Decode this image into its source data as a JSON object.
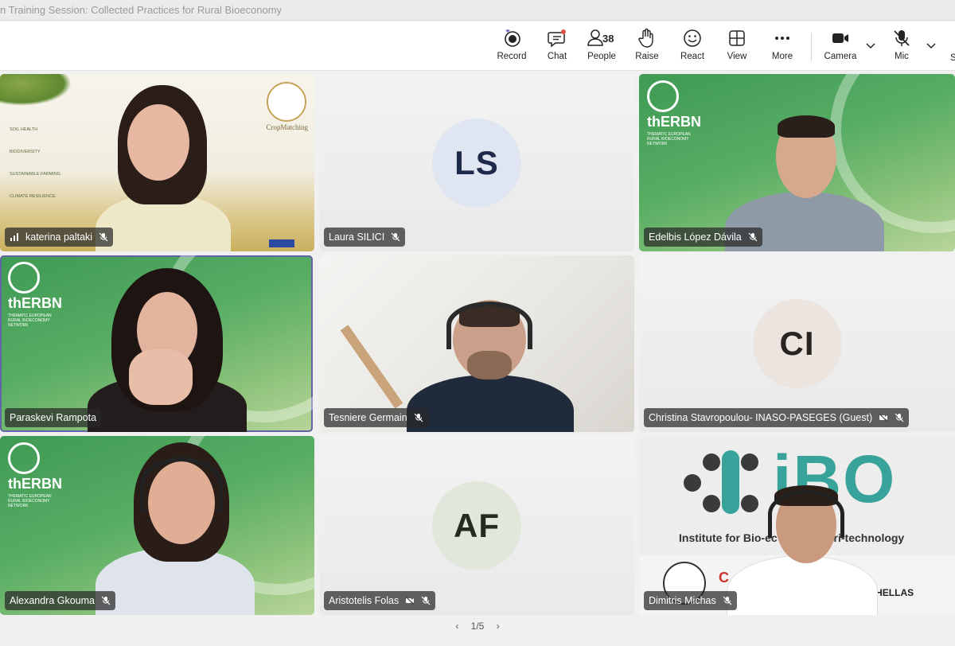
{
  "window": {
    "title": "n Training Session: Collected Practices for Rural Bioeconomy"
  },
  "toolbar": {
    "record": "Record",
    "chat": "Chat",
    "people": "People",
    "people_count": "38",
    "raise": "Raise",
    "react": "React",
    "view": "View",
    "more": "More",
    "camera": "Camera",
    "mic": "Mic",
    "share_initial": "S"
  },
  "tiles": [
    {
      "name": "katerina paltaki"
    },
    {
      "name": "Laura SILICI",
      "initials": "LS",
      "avatar_bg": "#dfe6f2",
      "avatar_fg": "#1f2a4a"
    },
    {
      "name": "Edelbis López Dávila"
    },
    {
      "name": "Paraskevi Rampota"
    },
    {
      "name": "Tesniere Germain"
    },
    {
      "name": "Christina Stavropoulou- INASO-PASEGES (Guest)",
      "initials": "CI",
      "avatar_bg": "#ece4de",
      "avatar_fg": "#2a2420"
    },
    {
      "name": "Alexandra Gkouma"
    },
    {
      "name": "Aristotelis Folas",
      "initials": "AF",
      "avatar_bg": "#e2e7dc",
      "avatar_fg": "#262b20"
    },
    {
      "name": "Dimitris Michas"
    }
  ],
  "backgrounds": {
    "cropmatching": {
      "brand": "CropMatching",
      "items": [
        "SOIL HEALTH",
        "BIODIVERSITY",
        "SUSTAINABLE FARMING",
        "CLIMATE RESILIENCE"
      ]
    },
    "therbn": {
      "brand": "thERBN",
      "tagline": "THEMATIC EUROPEAN RURAL BIOECONOMY NETWORK"
    },
    "ibo": {
      "brand": "iBO",
      "subtitle": "Institute for Bio-ec",
      "subtitle2": "gri-technology",
      "footer": "Y HELLAS",
      "footer_left": "C"
    }
  },
  "pager": {
    "text": "1/5"
  },
  "colors": {
    "accent": "#6264a7",
    "erbn_green": "#4aa25c",
    "ibo_teal": "#37a39a"
  }
}
